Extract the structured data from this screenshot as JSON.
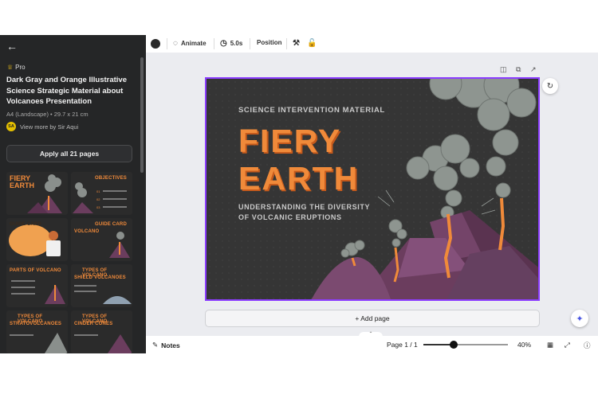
{
  "sidebar": {
    "back_icon": "arrow-left-icon",
    "badge": "Pro",
    "template_name": "Dark Gray and Orange Illustrative Science Strategic Material about Volcanoes Presentation",
    "size_label": "A4 (Landscape) • 29.7 x 21 cm",
    "author_initials": "SA",
    "author_link": "View more by Sir Aqui",
    "apply_label": "Apply all 21 pages",
    "thumbnails": [
      {
        "title": "FIERY EARTH"
      },
      {
        "title": "OBJECTIVES"
      },
      {
        "title": "GUIDE CARD"
      },
      {
        "title": "GUIDE CARD"
      },
      {
        "title": "PARTS OF VOLCANO"
      },
      {
        "title": "TYPES OF VOLCANO"
      },
      {
        "title": "TYPES OF VOLCANO"
      },
      {
        "title": "TYPES OF VOLCANO"
      }
    ],
    "thumbnail_subtitles": [
      "VOLCANO",
      "SHIELD VOLCANOES",
      "STRATOVOLCANOES",
      "CINDER CONES"
    ]
  },
  "toolbar": {
    "animate_label": "Animate",
    "duration_label": "5.0s",
    "position_label": "Position"
  },
  "slide": {
    "subtitle": "SCIENCE INTERVENTION MATERIAL",
    "title_line1": "FIERY",
    "title_line2": "EARTH",
    "description": "UNDERSTANDING THE DIVERSITY OF VOLCANIC ERUPTIONS"
  },
  "canvas": {
    "add_page_label": "+ Add page"
  },
  "footer": {
    "notes_label": "Notes",
    "page_label": "Page 1 / 1",
    "zoom_label": "40%",
    "zoom_fraction": 0.36
  },
  "colors": {
    "accent": "#8b3dff",
    "slide_bg": "#353535",
    "orange": "#f08a3a",
    "purple_volcano": "#6b3d5e"
  }
}
